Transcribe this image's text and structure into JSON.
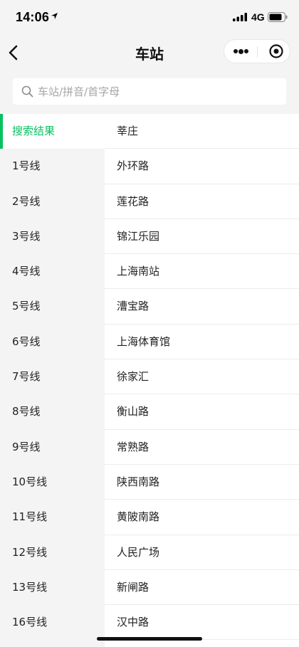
{
  "status_bar": {
    "time": "14:06",
    "network": "4G"
  },
  "nav": {
    "title": "车站"
  },
  "search": {
    "placeholder": "车站/拼音/首字母",
    "value": ""
  },
  "lines": [
    {
      "label": "搜索结果",
      "active": true
    },
    {
      "label": "1号线"
    },
    {
      "label": "2号线"
    },
    {
      "label": "3号线"
    },
    {
      "label": "4号线"
    },
    {
      "label": "5号线"
    },
    {
      "label": "6号线"
    },
    {
      "label": "7号线"
    },
    {
      "label": "8号线"
    },
    {
      "label": "9号线"
    },
    {
      "label": "10号线"
    },
    {
      "label": "11号线"
    },
    {
      "label": "12号线"
    },
    {
      "label": "13号线"
    },
    {
      "label": "16号线"
    }
  ],
  "stations": [
    "莘庄",
    "外环路",
    "莲花路",
    "锦江乐园",
    "上海南站",
    "漕宝路",
    "上海体育馆",
    "徐家汇",
    "衡山路",
    "常熟路",
    "陕西南路",
    "黄陂南路",
    "人民广场",
    "新闸路",
    "汉中路"
  ],
  "colors": {
    "accent": "#07c160",
    "background": "#f4f4f4"
  }
}
